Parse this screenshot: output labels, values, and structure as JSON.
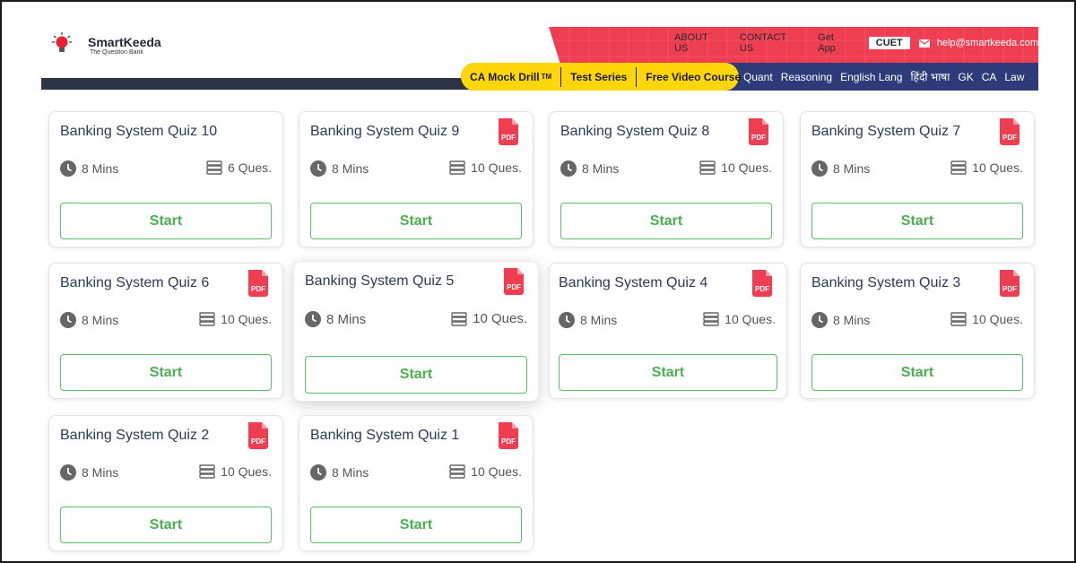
{
  "brand": {
    "name": "SmartKeeda",
    "tagline": "The Question Bank"
  },
  "top_links": [
    "ABOUT US",
    "CONTACT US",
    "Get App"
  ],
  "cuet_label": "CUET",
  "email": "help@smartkeeda.com",
  "highlight_nav": {
    "mock_drill": "CA Mock Drill",
    "mock_drill_tm": "TM",
    "test_series": "Test Series",
    "free_video": "Free Video Course"
  },
  "nav_links": [
    "Quant",
    "Reasoning",
    "English Lang",
    "हिंदी भाषा",
    "GK",
    "CA",
    "Law"
  ],
  "colors": {
    "accent_red": "#ef3d52",
    "nav_blue": "#2d3c78",
    "highlight_yellow": "#ffd60a",
    "start_green": "#4caf50"
  },
  "quizzes": [
    {
      "title": "Banking System Quiz 10",
      "time": "8 Mins",
      "questions": "6 Ques.",
      "button": "Start",
      "has_pdf": false
    },
    {
      "title": "Banking System Quiz 9",
      "time": "8 Mins",
      "questions": "10 Ques.",
      "button": "Start",
      "has_pdf": true
    },
    {
      "title": "Banking System Quiz 8",
      "time": "8 Mins",
      "questions": "10 Ques.",
      "button": "Start",
      "has_pdf": true
    },
    {
      "title": "Banking System Quiz 7",
      "time": "8 Mins",
      "questions": "10 Ques.",
      "button": "Start",
      "has_pdf": true
    },
    {
      "title": "Banking System Quiz 6",
      "time": "8 Mins",
      "questions": "10 Ques.",
      "button": "Start",
      "has_pdf": true
    },
    {
      "title": "Banking System Quiz 5",
      "time": "8 Mins",
      "questions": "10 Ques.",
      "button": "Start",
      "has_pdf": true
    },
    {
      "title": "Banking System Quiz 4",
      "time": "8 Mins",
      "questions": "10 Ques.",
      "button": "Start",
      "has_pdf": true
    },
    {
      "title": "Banking System Quiz 3",
      "time": "8 Mins",
      "questions": "10 Ques.",
      "button": "Start",
      "has_pdf": true
    },
    {
      "title": "Banking System Quiz 2",
      "time": "8 Mins",
      "questions": "10 Ques.",
      "button": "Start",
      "has_pdf": true
    },
    {
      "title": "Banking System Quiz 1",
      "time": "8 Mins",
      "questions": "10 Ques.",
      "button": "Start",
      "has_pdf": true
    }
  ]
}
